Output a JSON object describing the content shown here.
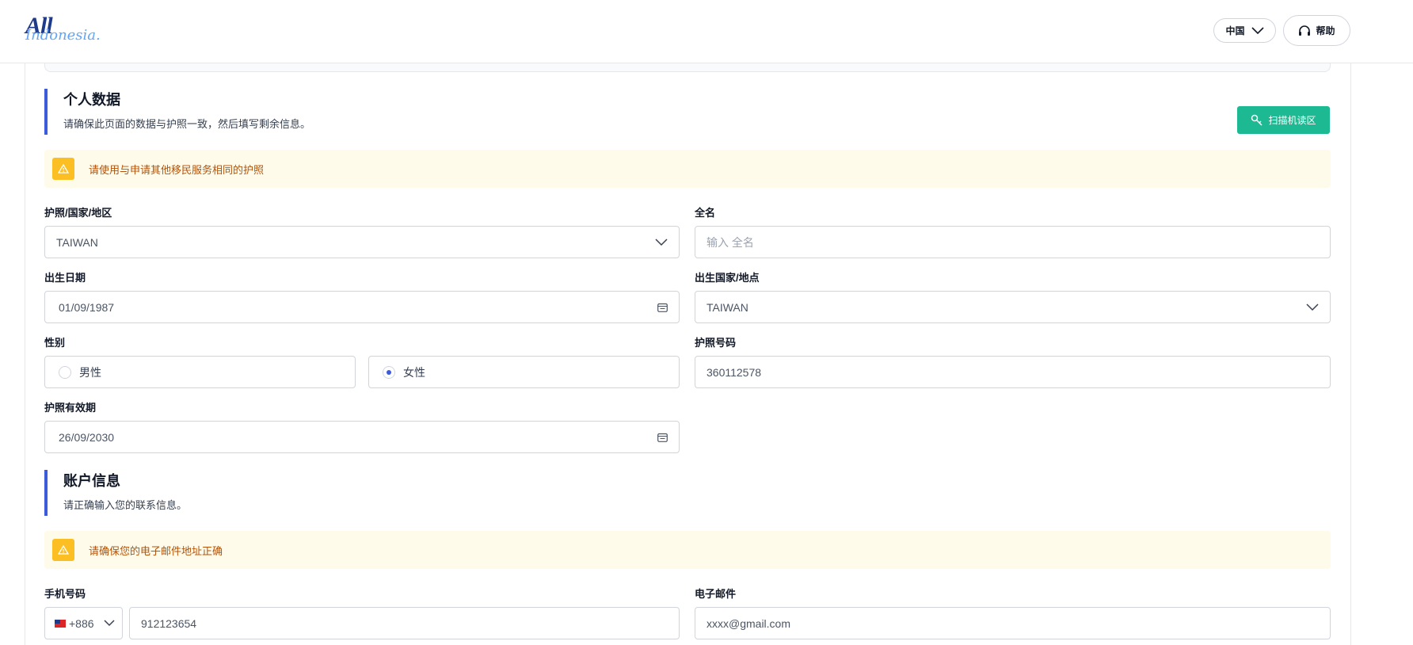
{
  "header": {
    "logo_text_1": "All",
    "logo_text_2": "Indonesia.",
    "language": "中国",
    "help": "帮助"
  },
  "personal": {
    "title": "个人数据",
    "subtitle": "请确保此页面的数据与护照一致，然后填写剩余信息。",
    "scan_button": "扫描机读区",
    "alert": "请使用与申请其他移民服务相同的护照",
    "passport_country_label": "护照/国家/地区",
    "passport_country_value": "TAIWAN",
    "full_name_label": "全名",
    "full_name_placeholder": "输入 全名",
    "dob_label": "出生日期",
    "dob_value": "01/09/1987",
    "birth_place_label": "出生国家/地点",
    "birth_place_value": "TAIWAN",
    "gender_label": "性别",
    "gender_male": "男性",
    "gender_female": "女性",
    "gender_selected": "女性",
    "passport_no_label": "护照号码",
    "passport_no_value": "360112578",
    "passport_expiry_label": "护照有效期",
    "passport_expiry_value": "26/09/2030"
  },
  "account": {
    "title": "账户信息",
    "subtitle": "请正确输入您的联系信息。",
    "alert": "请确保您的电子邮件地址正确",
    "phone_label": "手机号码",
    "country_code": "+886",
    "phone_value": "912123654",
    "email_label": "电子邮件",
    "email_value": "xxxx@gmail.com"
  },
  "colors": {
    "accent": "#3b5bdb",
    "scan_button": "#1db992",
    "alert_bg": "#fefbea",
    "alert_icon": "#fbbf24",
    "alert_text": "#b45309"
  }
}
